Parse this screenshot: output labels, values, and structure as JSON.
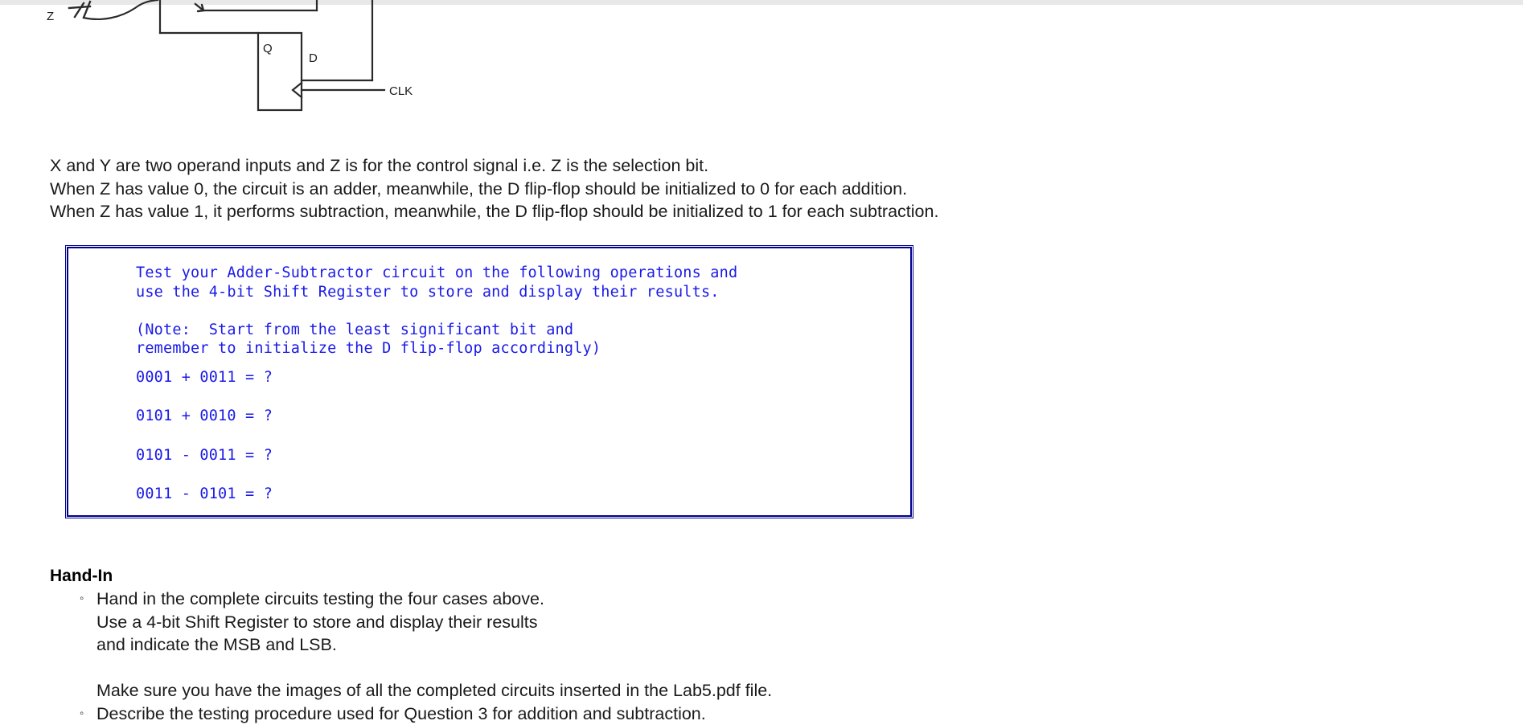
{
  "colors": {
    "box_border": "#00008f",
    "mono_text": "#1a1ae8",
    "body_text": "#1a1a1a",
    "wire": "#2a2a2a",
    "top_strip": "#e8e8e8"
  },
  "diagram": {
    "labels": {
      "z": "Z",
      "q": "Q",
      "d": "D",
      "clk": "CLK"
    }
  },
  "paragraphs": [
    "X and Y are two operand inputs and Z is for the control signal i.e. Z is the selection bit.",
    "When Z has value 0, the circuit is an adder, meanwhile, the D flip-flop should be initialized to 0 for each addition.",
    "When Z has value 1, it performs subtraction, meanwhile, the D flip-flop should be initialized to 1 for each subtraction."
  ],
  "blue_box": {
    "intro": [
      "Test your Adder-Subtractor circuit on the following operations and",
      "use the 4-bit Shift Register to store and display their results."
    ],
    "note": [
      "(Note:  Start from the least significant bit and",
      "remember to initialize the D flip-flop accordingly)"
    ],
    "operations": [
      "0001 + 0011 = ?",
      "0101 + 0010 = ?",
      "0101 - 0011 = ?",
      "0011 - 0101 = ?"
    ]
  },
  "handin": {
    "title": "Hand-In",
    "bullet_glyph": "◦",
    "items": [
      {
        "lines": [
          "Hand in the complete circuits testing the four cases above.",
          "Use a 4-bit Shift Register to store and display their results",
          "and indicate the MSB and LSB.",
          "",
          "Make sure you have the images of all the completed circuits inserted in the Lab5.pdf file."
        ]
      },
      {
        "lines": [
          "Describe the testing procedure used for Question 3 for addition and subtraction."
        ]
      }
    ]
  }
}
